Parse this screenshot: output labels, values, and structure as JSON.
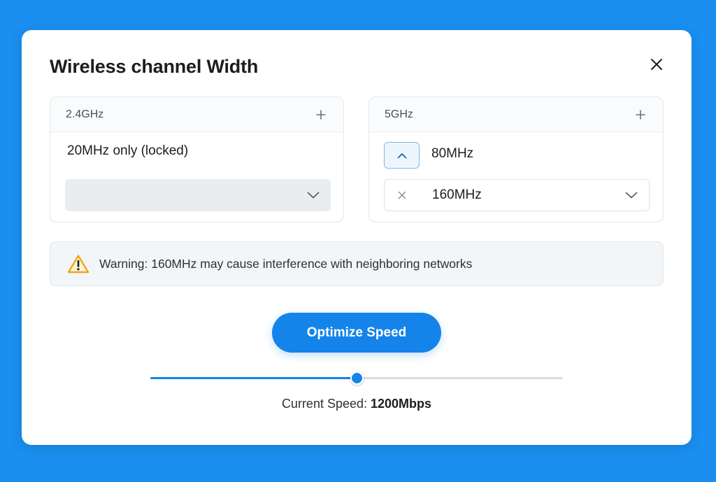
{
  "dialog": {
    "title": "Wireless channel Width"
  },
  "band_24": {
    "label": "2.4GHz",
    "status_text": "20MHz only (locked)"
  },
  "band_5": {
    "label": "5GHz",
    "option_80": "80MHz",
    "selected": "160MHz"
  },
  "warning": {
    "text": "Warning: 160MHz may cause interference with neighboring networks"
  },
  "actions": {
    "optimize_label": "Optimize Speed"
  },
  "speed": {
    "label": "Current Speed:",
    "value": "1200Mbps",
    "slider_fraction": 0.5
  },
  "colors": {
    "accent": "#1484ea",
    "background": "#1a8ff0",
    "warning": "#f2a516"
  },
  "icons": {
    "close": "close-icon",
    "expand": "plus-icon",
    "collapse": "chevron-up-icon",
    "dropdown": "chevron-down-icon",
    "clear": "clear-x-icon",
    "warning": "warning-triangle-icon"
  }
}
